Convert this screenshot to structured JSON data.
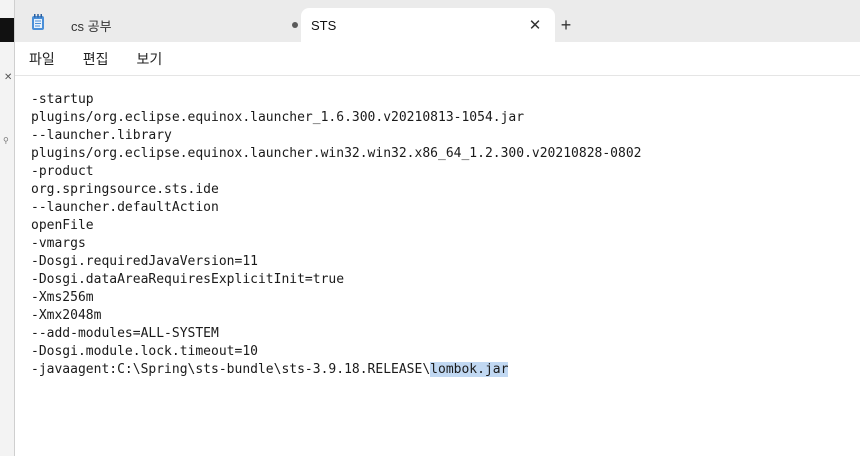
{
  "tabs": [
    {
      "title": "cs 공부",
      "modified": true
    },
    {
      "title": "STS",
      "active": true
    }
  ],
  "new_tab_label": "+",
  "menu": [
    "파일",
    "편집",
    "보기"
  ],
  "editor_lines": [
    "-startup",
    "plugins/org.eclipse.equinox.launcher_1.6.300.v20210813-1054.jar",
    "--launcher.library",
    "plugins/org.eclipse.equinox.launcher.win32.win32.x86_64_1.2.300.v20210828-0802",
    "-product",
    "org.springsource.sts.ide",
    "--launcher.defaultAction",
    "openFile",
    "-vmargs",
    "-Dosgi.requiredJavaVersion=11",
    "-Dosgi.dataAreaRequiresExplicitInit=true",
    "-Xms256m",
    "-Xmx2048m",
    "--add-modules=ALL-SYSTEM",
    "-Dosgi.module.lock.timeout=10"
  ],
  "last_line": {
    "prefix": "-javaagent:C:\\Spring\\sts-bundle\\sts-3.9.18.RELEASE\\",
    "selected": "lombok.jar"
  },
  "colors": {
    "selection": "#c1d8f2",
    "tabbar": "#ebebeb"
  }
}
